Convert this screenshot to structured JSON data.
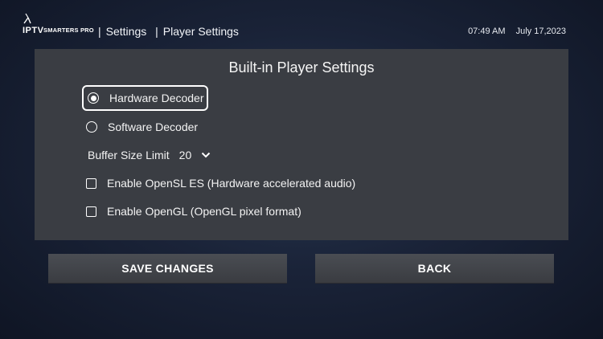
{
  "header": {
    "logo": {
      "prefix": "IPTV",
      "brand": "SMARTERS PRO"
    },
    "breadcrumb": {
      "section": "Settings",
      "page": "Player Settings",
      "separator": "|"
    },
    "time": "07:49 AM",
    "date": "July 17,2023"
  },
  "panel": {
    "title": "Built-in Player Settings",
    "decoder_options": [
      {
        "label": "Hardware Decoder",
        "selected": true,
        "focused": true
      },
      {
        "label": "Software Decoder",
        "selected": false,
        "focused": false
      }
    ],
    "buffer": {
      "label": "Buffer Size Limit",
      "value": "20",
      "icon": "chevron-down-icon"
    },
    "checkboxes": [
      {
        "label": "Enable OpenSL ES (Hardware accelerated audio)",
        "checked": false
      },
      {
        "label": "Enable OpenGL (OpenGL pixel format)",
        "checked": false
      }
    ]
  },
  "buttons": {
    "save": "SAVE CHANGES",
    "back": "BACK"
  },
  "colors": {
    "panel": "#3a3d43",
    "button": "#45484e",
    "background": "#1a2338"
  }
}
